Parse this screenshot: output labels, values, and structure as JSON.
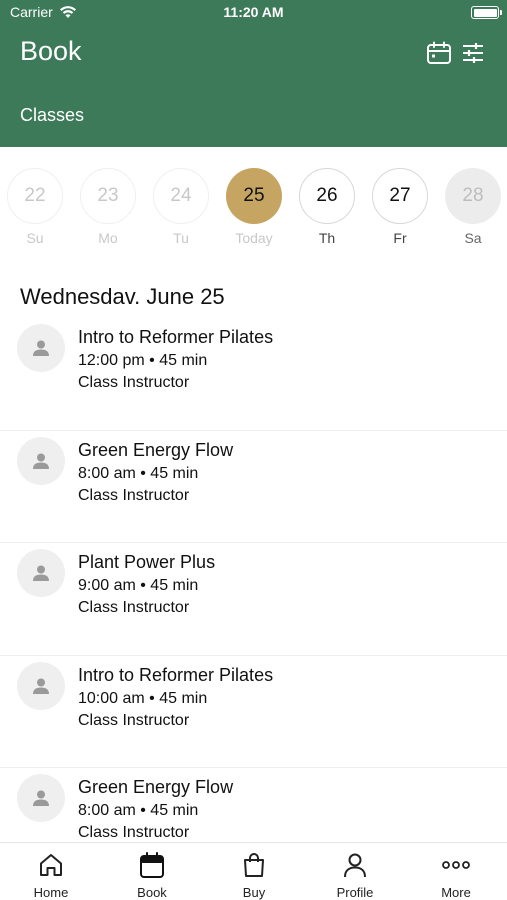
{
  "status_bar": {
    "carrier": "Carrier",
    "time": "11:20 AM"
  },
  "header": {
    "title": "Book",
    "subtitle": "Classes",
    "background_color": "#3d7a5a",
    "icons": [
      "calendar-icon",
      "filter-sliders-icon"
    ]
  },
  "week": {
    "days": [
      {
        "number": "22",
        "label": "Su",
        "state": "past"
      },
      {
        "number": "23",
        "label": "Mo",
        "state": "past"
      },
      {
        "number": "24",
        "label": "Tu",
        "state": "past"
      },
      {
        "number": "25",
        "label": "Today",
        "state": "selected"
      },
      {
        "number": "26",
        "label": "Th",
        "state": "available"
      },
      {
        "number": "27",
        "label": "Fr",
        "state": "available"
      },
      {
        "number": "28",
        "label": "Sa",
        "state": "disabled"
      }
    ],
    "selected_color": "#c6a462"
  },
  "date_heading": "Wednesdav. June 25",
  "classes": [
    {
      "name": "Intro to Reformer Pilates",
      "meta": "12:00 pm • 45 min",
      "instructor": "Class Instructor"
    },
    {
      "name": "Green Energy Flow",
      "meta": "8:00 am • 45 min",
      "instructor": "Class Instructor"
    },
    {
      "name": "Plant Power Plus",
      "meta": "9:00 am • 45 min",
      "instructor": "Class Instructor"
    },
    {
      "name": "Intro to Reformer Pilates",
      "meta": "10:00 am • 45 min",
      "instructor": "Class Instructor"
    },
    {
      "name": "Green Energy Flow",
      "meta": "8:00 am • 45 min",
      "instructor": "Class Instructor"
    }
  ],
  "tab_bar": {
    "tabs": [
      {
        "label": "Home",
        "icon": "home-icon"
      },
      {
        "label": "Book",
        "icon": "calendar-filled-icon",
        "active": true
      },
      {
        "label": "Buy",
        "icon": "shopping-bag-icon"
      },
      {
        "label": "Profile",
        "icon": "person-icon"
      },
      {
        "label": "More",
        "icon": "more-dots-icon"
      }
    ]
  }
}
